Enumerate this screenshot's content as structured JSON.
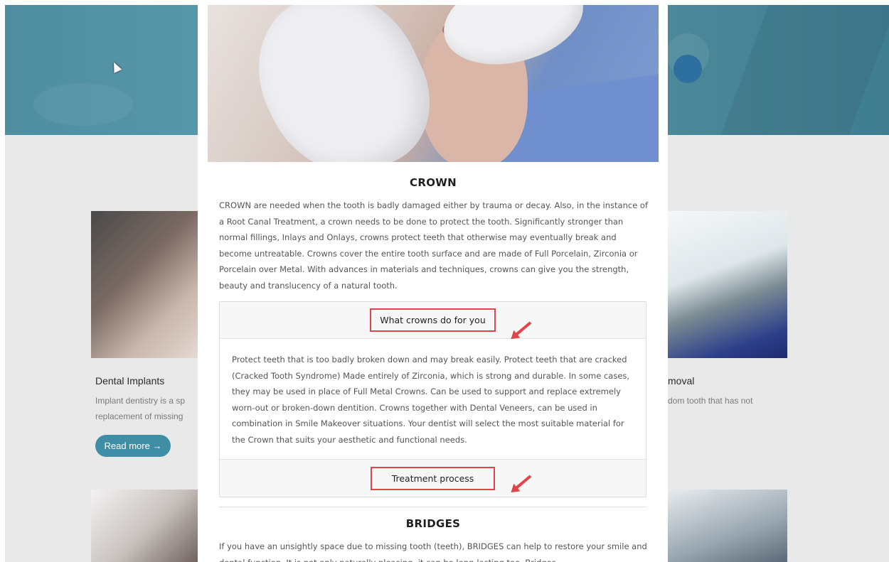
{
  "background": {
    "left_card": {
      "title": "Dental Implants",
      "text_line1": "Implant dentistry is a sp",
      "text_line2": "replacement of missing",
      "button": "Read more →"
    },
    "right_card": {
      "title": "moval",
      "text_line1": "dom tooth that has not"
    }
  },
  "modal": {
    "section1": {
      "title": "CROWN",
      "paragraph": "CROWN are needed when the tooth is badly damaged either by trauma or decay. Also, in the instance of a Root Canal Treatment, a crown needs to be done to protect the tooth. Significantly stronger than normal fillings, Inlays and Onlays, crowns protect teeth that otherwise may eventually break and become untreatable. Crowns cover the entire tooth surface and are made of Full Porcelain, Zirconia or Porcelain over Metal. With advances in materials and techniques, crowns can give you the strength, beauty and translucency of a natural tooth.",
      "accordion": [
        {
          "label": "What crowns do for you",
          "body": "Protect teeth that is too badly broken down and may break easily. Protect teeth that are cracked (Cracked Tooth Syndrome) Made entirely of Zirconia, which is strong and durable. In some cases, they may be used in place of Full Metal Crowns. Can be used to support and replace extremely worn-out or broken-down dentition. Crowns together with Dental Veneers, can be used in combination in Smile Makeover situations. Your dentist will select the most suitable material for the Crown that suits your aesthetic and functional needs."
        },
        {
          "label": "Treatment process"
        }
      ]
    },
    "section2": {
      "title": "BRIDGES",
      "paragraph": "If you have an unsightly space due to missing tooth (teeth), BRIDGES can help to restore your smile and dental function. It is not only naturally pleasing, it can be long-lasting too. Bridges"
    }
  },
  "colors": {
    "annotation_red": "#e0444b",
    "hero_teal": "#5c9bae",
    "button_teal": "#3f8ea6"
  }
}
